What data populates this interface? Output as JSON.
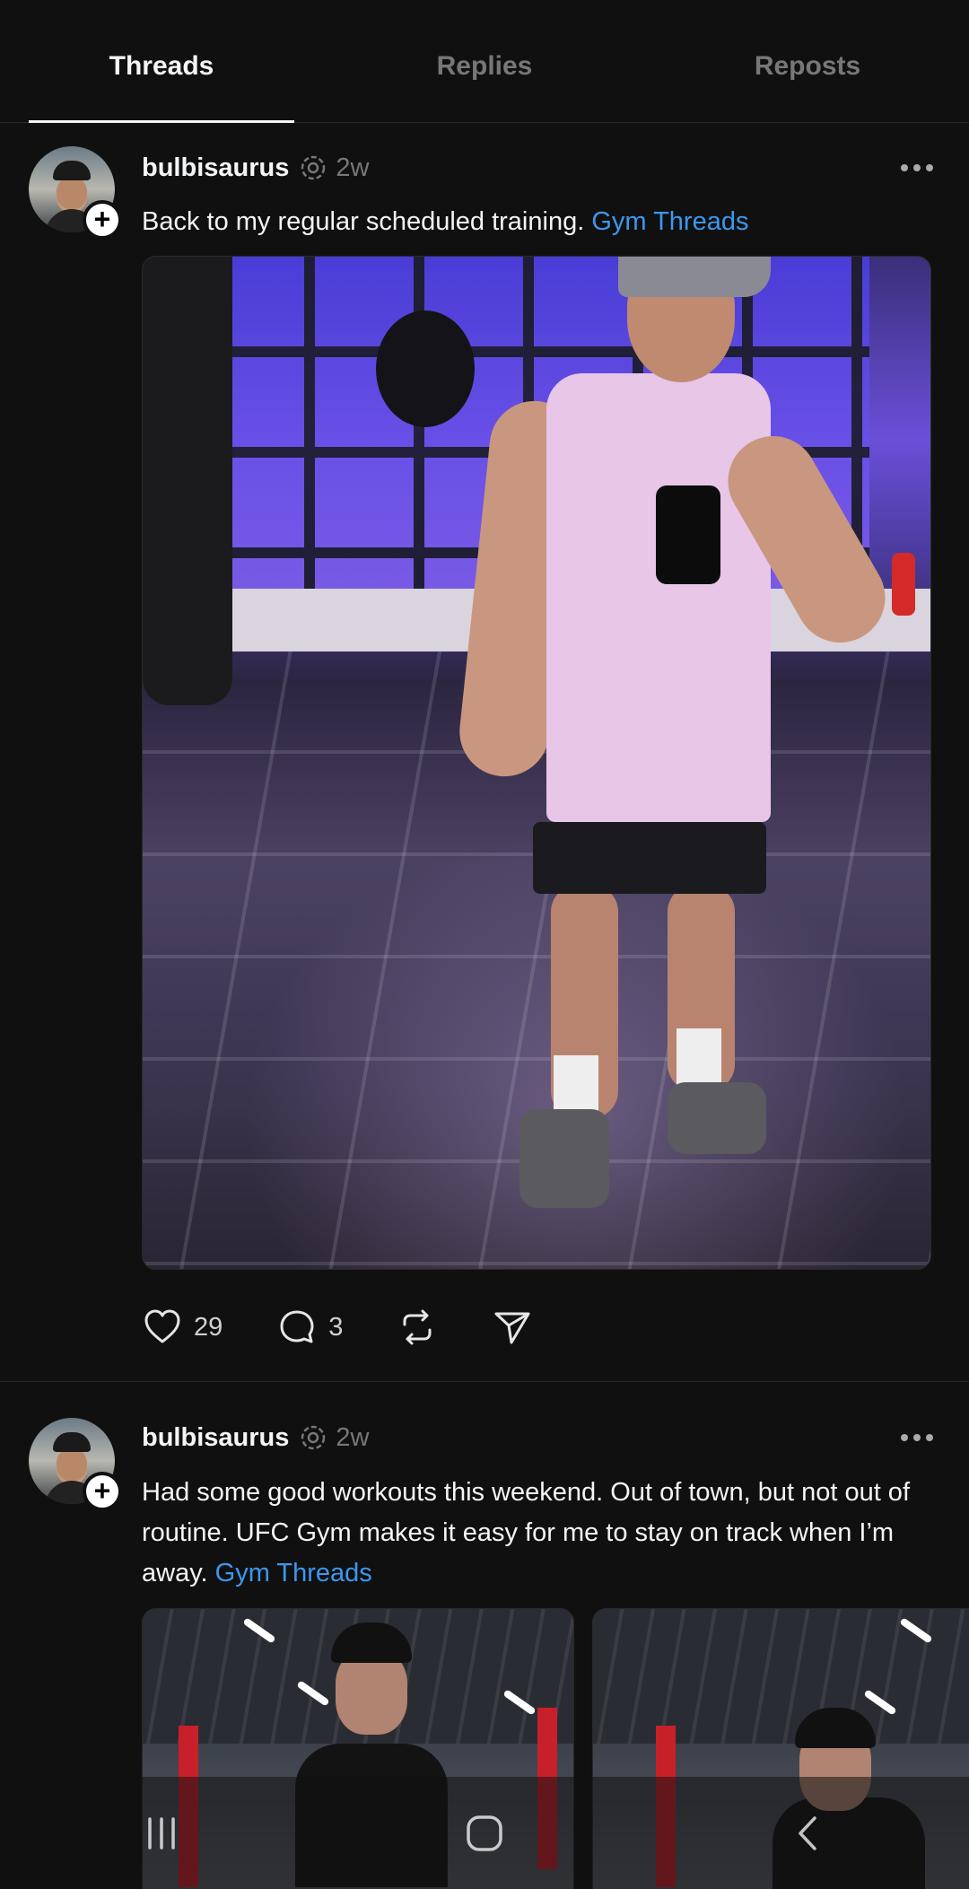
{
  "tabs": [
    {
      "label": "Threads",
      "active": true
    },
    {
      "label": "Replies",
      "active": false
    },
    {
      "label": "Reposts",
      "active": false
    }
  ],
  "posts": [
    {
      "username": "bulbisaurus",
      "time": "2w",
      "text": "Back to my regular scheduled training.",
      "tag": "Gym Threads",
      "likes": "29",
      "replies": "3",
      "image_alt": "gym mirror selfie"
    },
    {
      "username": "bulbisaurus",
      "time": "2w",
      "text": "Had some good workouts this weekend. Out of town, but not out of routine. UFC Gym makes it easy for me to stay on track when I’m away.",
      "tag": "Gym Threads"
    }
  ],
  "icons": {
    "verify": "threads-badge-icon",
    "like": "heart-icon",
    "reply": "comment-icon",
    "repost": "repost-icon",
    "share": "send-icon",
    "more": "more-dots-icon"
  },
  "colors": {
    "background": "#101010",
    "link": "#3b98f0",
    "muted": "#777777",
    "text": "#f3f5f7"
  },
  "navbar": [
    "recent-apps-icon",
    "home-icon",
    "back-icon"
  ]
}
